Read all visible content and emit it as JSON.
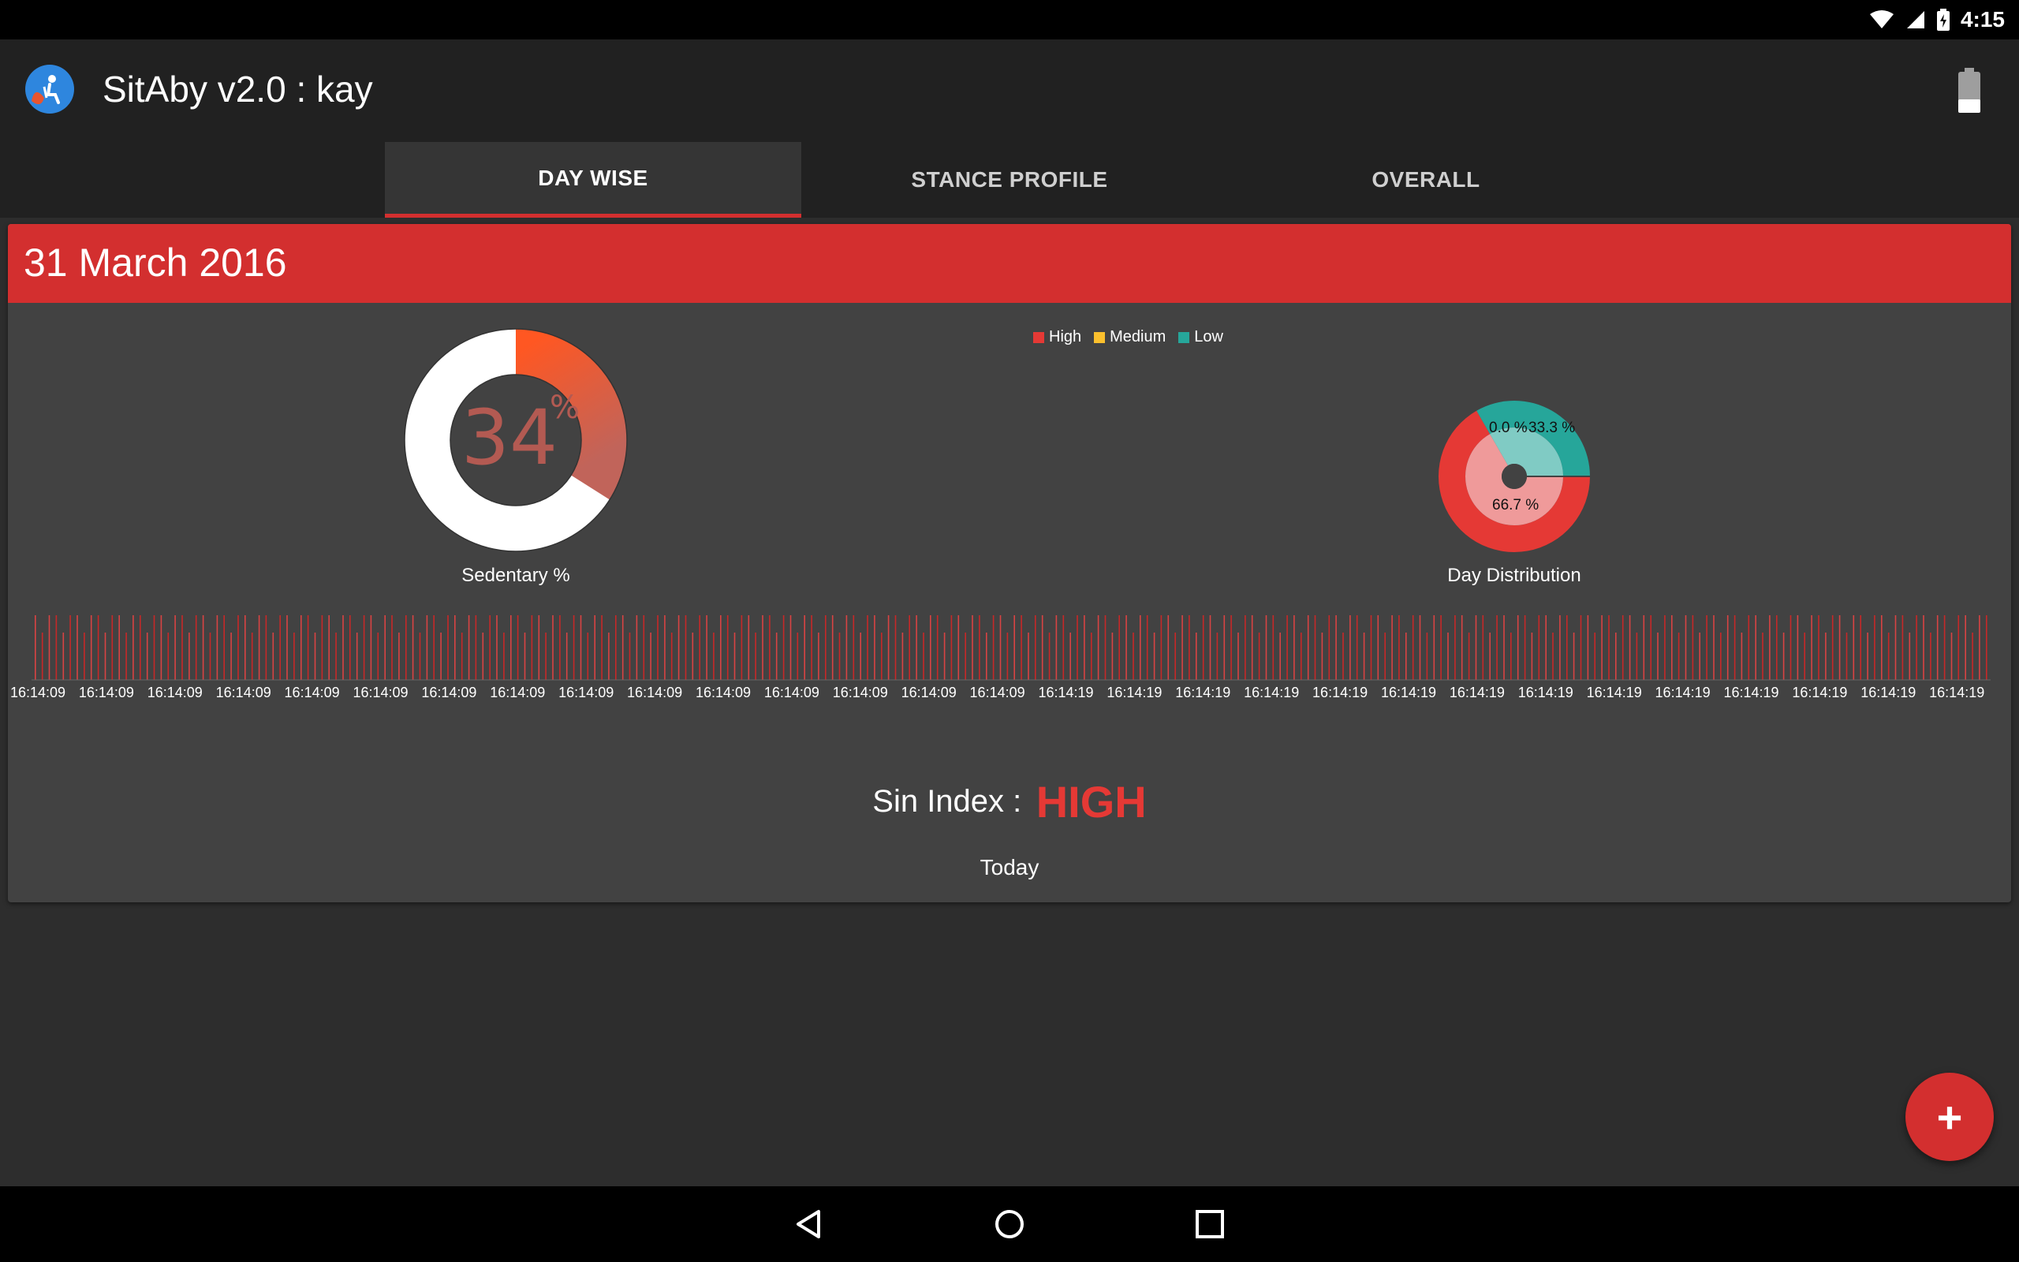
{
  "status_bar": {
    "time": "4:15",
    "icons": [
      "wifi-icon",
      "signal-icon",
      "battery-charging-icon"
    ]
  },
  "app_bar": {
    "title": "SitAby v2.0 : kay",
    "logo_icon": "sitaby-logo-icon",
    "action_icon": "battery-icon"
  },
  "tabs": [
    {
      "label": "DAY WISE",
      "active": true
    },
    {
      "label": "STANCE PROFILE",
      "active": false
    },
    {
      "label": "OVERALL",
      "active": false
    }
  ],
  "card": {
    "date": "31 March 2016",
    "sedentary": {
      "value": "34",
      "unit": "%",
      "caption": "Sedentary %",
      "fraction": 0.34
    },
    "distribution": {
      "caption": "Day Distribution",
      "legend": [
        {
          "name": "High",
          "color": "#e53935"
        },
        {
          "name": "Medium",
          "color": "#fbc02d"
        },
        {
          "name": "Low",
          "color": "#26a69a"
        }
      ]
    },
    "sin_index": {
      "label": "Sin Index :",
      "value": "HIGH"
    },
    "footer": "Today"
  },
  "chart_data": [
    {
      "type": "pie",
      "title": "Day Distribution",
      "categories": [
        "High",
        "Medium",
        "Low"
      ],
      "values": [
        66.7,
        0.0,
        33.3
      ],
      "data_labels": [
        "66.7 %",
        "0.0 %",
        "33.3 %"
      ],
      "colors": [
        "#e53935",
        "#fbc02d",
        "#26a69a"
      ],
      "legend": "top"
    },
    {
      "type": "bar",
      "title": "",
      "tick_labels": [
        "16:14:09",
        "16:14:09",
        "16:14:09",
        "16:14:09",
        "16:14:09",
        "16:14:09",
        "16:14:09",
        "16:14:09",
        "16:14:09",
        "16:14:09",
        "16:14:09",
        "16:14:09",
        "16:14:09",
        "16:14:09",
        "16:14:09",
        "16:14:19",
        "16:14:19",
        "16:14:19",
        "16:14:19",
        "16:14:19",
        "16:14:19",
        "16:14:19",
        "16:14:19",
        "16:14:19",
        "16:14:19",
        "16:14:19",
        "16:14:19",
        "16:14:19",
        "16:14:19"
      ],
      "grid": false
    }
  ],
  "fab": {
    "label": "+"
  },
  "nav": {
    "back_icon": "back-icon",
    "home_icon": "home-icon",
    "recents_icon": "recents-icon"
  }
}
